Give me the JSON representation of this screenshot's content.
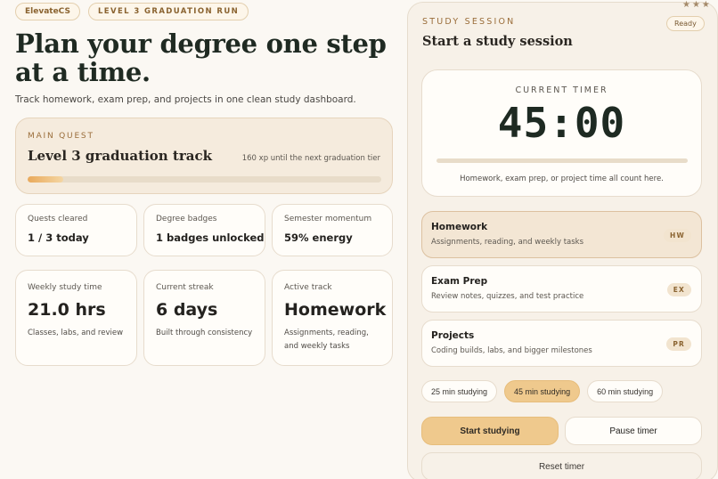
{
  "header": {
    "brand": "ElevateCS",
    "run_label": "LEVEL 3 GRADUATION RUN"
  },
  "hero": {
    "title": "Plan your degree one step at a time.",
    "subtitle": "Track homework, exam prep, and projects in one clean study dashboard."
  },
  "quest": {
    "eyebrow": "MAIN QUEST",
    "title": "Level 3 graduation track",
    "xp_note": "160 xp until the next graduation tier",
    "progress": 0.1
  },
  "stats": [
    {
      "label": "Quests cleared",
      "value": "1 / 3 today"
    },
    {
      "label": "Degree badges",
      "value": "1 badges unlocked"
    },
    {
      "label": "Semester momentum",
      "value": "59% energy"
    }
  ],
  "metrics": [
    {
      "label": "Weekly study time",
      "value": "21.0 hrs",
      "desc": "Classes, labs, and review"
    },
    {
      "label": "Current streak",
      "value": "6 days",
      "desc": "Built through consistency"
    },
    {
      "label": "Active track",
      "value": "Homework",
      "desc": "Assignments, reading, and weekly tasks"
    }
  ],
  "session": {
    "eyebrow": "STUDY SESSION",
    "title": "Start a study session",
    "status": "Ready",
    "stars": "★★★",
    "timer_label": "CURRENT TIMER",
    "timer_value": "45:00",
    "timer_progress": 0,
    "timer_desc": "Homework, exam prep, or project time all count here."
  },
  "tracks": [
    {
      "name": "Homework",
      "desc": "Assignments, reading, and weekly tasks",
      "badge": "HW",
      "active": true
    },
    {
      "name": "Exam Prep",
      "desc": "Review notes, quizzes, and test practice",
      "badge": "EX",
      "active": false
    },
    {
      "name": "Projects",
      "desc": "Coding builds, labs, and bigger milestones",
      "badge": "PR",
      "active": false
    }
  ],
  "durations": [
    {
      "label": "25 min studying",
      "selected": false
    },
    {
      "label": "45 min studying",
      "selected": true
    },
    {
      "label": "60 min studying",
      "selected": false
    }
  ],
  "actions": {
    "start": "Start studying",
    "pause": "Pause timer",
    "reset": "Reset timer"
  },
  "colors": {
    "accent": "#efc98d",
    "brand_text": "#8a6330",
    "title_dark": "#1f2a22",
    "background": "#fbf8f3"
  }
}
